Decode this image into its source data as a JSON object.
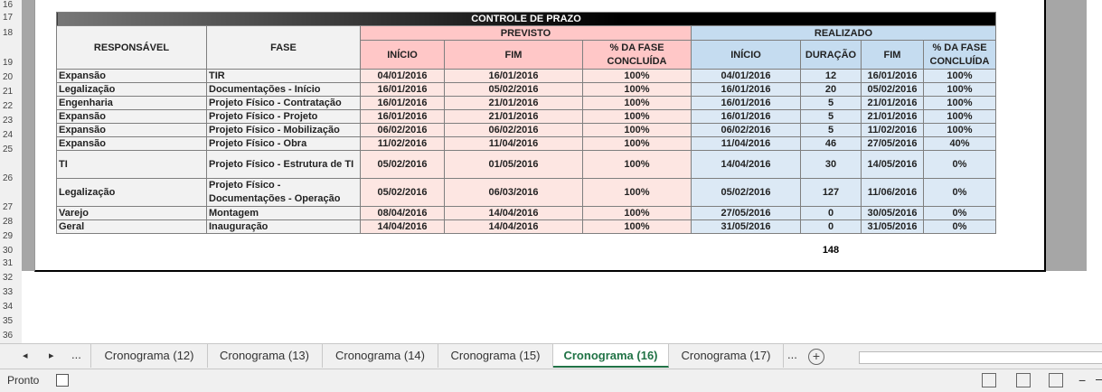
{
  "row_numbers": [
    "16",
    "17",
    "18",
    "19",
    "20",
    "21",
    "22",
    "23",
    "24",
    "25",
    "26",
    "27",
    "28",
    "29",
    "30",
    "31",
    "32",
    "33",
    "34",
    "35",
    "36"
  ],
  "sheet": {
    "title": "CONTROLE DE PRAZO",
    "headers": {
      "responsavel": "RESPONSÁVEL",
      "fase": "FASE",
      "previsto": "PREVISTO",
      "realizado": "REALIZADO",
      "inicio": "INÍCIO",
      "fim": "FIM",
      "pct": "% DA FASE CONCLUÍDA",
      "duracao": "DURAÇÃO"
    },
    "rows": [
      {
        "resp": "Expansão",
        "fase": "TIR",
        "p_inicio": "04/01/2016",
        "p_fim": "16/01/2016",
        "p_pct": "100%",
        "r_inicio": "04/01/2016",
        "dur": "12",
        "r_fim": "16/01/2016",
        "r_pct": "100%"
      },
      {
        "resp": "Legalização",
        "fase": "Documentações - Início",
        "p_inicio": "16/01/2016",
        "p_fim": "05/02/2016",
        "p_pct": "100%",
        "r_inicio": "16/01/2016",
        "dur": "20",
        "r_fim": "05/02/2016",
        "r_pct": "100%"
      },
      {
        "resp": "Engenharia",
        "fase": "Projeto Físico - Contratação",
        "p_inicio": "16/01/2016",
        "p_fim": "21/01/2016",
        "p_pct": "100%",
        "r_inicio": "16/01/2016",
        "dur": "5",
        "r_fim": "21/01/2016",
        "r_pct": "100%"
      },
      {
        "resp": "Expansão",
        "fase": "Projeto Físico - Projeto",
        "p_inicio": "16/01/2016",
        "p_fim": "21/01/2016",
        "p_pct": "100%",
        "r_inicio": "16/01/2016",
        "dur": "5",
        "r_fim": "21/01/2016",
        "r_pct": "100%"
      },
      {
        "resp": "Expansão",
        "fase": "Projeto Físico - Mobilização",
        "p_inicio": "06/02/2016",
        "p_fim": "06/02/2016",
        "p_pct": "100%",
        "r_inicio": "06/02/2016",
        "dur": "5",
        "r_fim": "11/02/2016",
        "r_pct": "100%"
      },
      {
        "resp": "Expansão",
        "fase": "Projeto Físico - Obra",
        "p_inicio": "11/02/2016",
        "p_fim": "11/04/2016",
        "p_pct": "100%",
        "r_inicio": "11/04/2016",
        "dur": "46",
        "r_fim": "27/05/2016",
        "r_pct": "40%"
      },
      {
        "resp": "TI",
        "fase": "Projeto Físico - Estrutura de TI",
        "p_inicio": "05/02/2016",
        "p_fim": "01/05/2016",
        "p_pct": "100%",
        "r_inicio": "14/04/2016",
        "dur": "30",
        "r_fim": "14/05/2016",
        "r_pct": "0%"
      },
      {
        "resp": "Legalização",
        "fase": "Projeto Físico - Documentações - Operação",
        "p_inicio": "05/02/2016",
        "p_fim": "06/03/2016",
        "p_pct": "100%",
        "r_inicio": "05/02/2016",
        "dur": "127",
        "r_fim": "11/06/2016",
        "r_pct": "0%"
      },
      {
        "resp": "Varejo",
        "fase": "Montagem",
        "p_inicio": "08/04/2016",
        "p_fim": "14/04/2016",
        "p_pct": "100%",
        "r_inicio": "27/05/2016",
        "dur": "0",
        "r_fim": "30/05/2016",
        "r_pct": "0%"
      },
      {
        "resp": "Geral",
        "fase": "Inauguração",
        "p_inicio": "14/04/2016",
        "p_fim": "14/04/2016",
        "p_pct": "100%",
        "r_inicio": "31/05/2016",
        "dur": "0",
        "r_fim": "31/05/2016",
        "r_pct": "0%"
      }
    ],
    "total_duracao": "148"
  },
  "tabs": {
    "nav_prev": "◂",
    "nav_next": "▸",
    "more_left": "...",
    "more_right": "...",
    "items": [
      "Cronograma (12)",
      "Cronograma (13)",
      "Cronograma (14)",
      "Cronograma (15)",
      "Cronograma (16)",
      "Cronograma (17)"
    ],
    "active_index": 4,
    "add": "+"
  },
  "status": {
    "text": "Pronto"
  },
  "colors": {
    "accent": "#217346",
    "previsto": "#fde6e2",
    "realizado": "#dce9f5"
  }
}
